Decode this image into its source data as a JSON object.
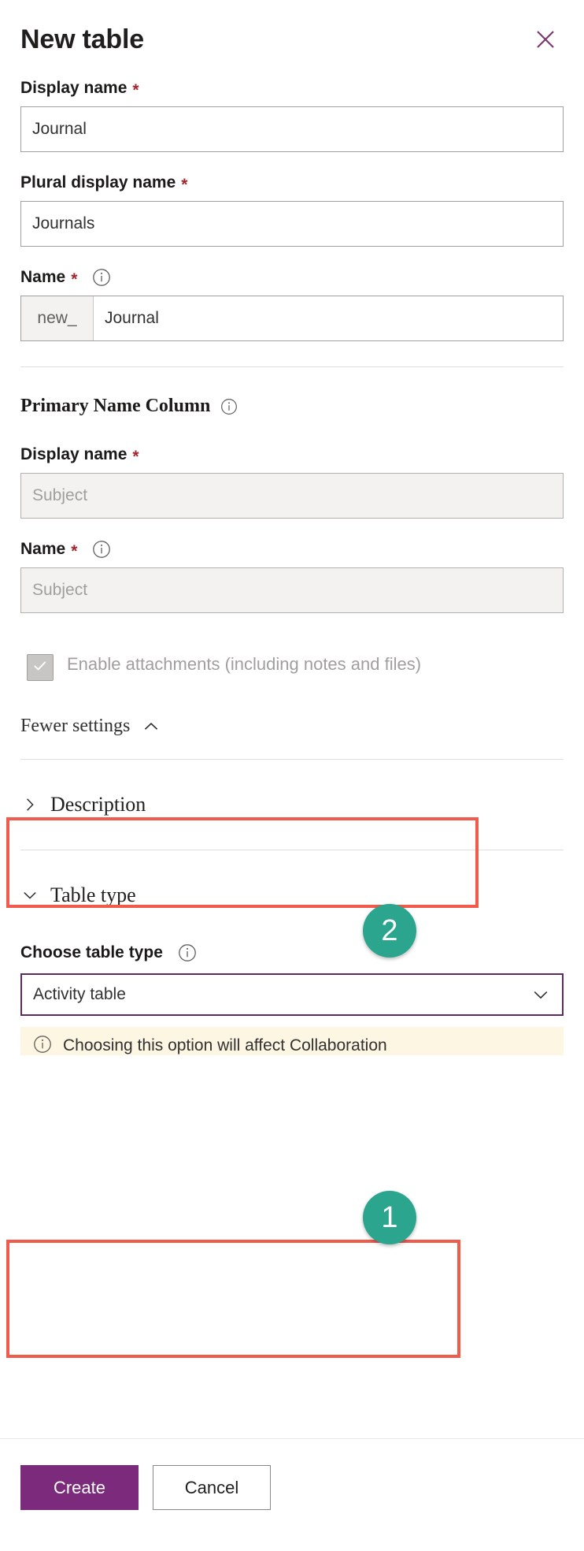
{
  "header": {
    "title": "New table",
    "close_icon": "close-icon"
  },
  "form": {
    "display_name": {
      "label": "Display name",
      "required_marker": "*",
      "value": "Journal"
    },
    "plural_display_name": {
      "label": "Plural display name",
      "required_marker": "*",
      "value": "Journals"
    },
    "name": {
      "label": "Name",
      "required_marker": "*",
      "prefix": "new_",
      "value": "Journal",
      "info_icon": "info-icon"
    },
    "primary_name_column": {
      "heading": "Primary Name Column",
      "info_icon": "info-icon",
      "display_name": {
        "label": "Display name",
        "required_marker": "*",
        "placeholder": "Subject",
        "value": "",
        "disabled": true
      },
      "name": {
        "label": "Name",
        "required_marker": "*",
        "placeholder": "Subject",
        "value": "",
        "disabled": true,
        "info_icon": "info-icon"
      }
    },
    "enable_attachments": {
      "label": "Enable attachments (including notes and files)",
      "checked": true,
      "disabled": true,
      "check_icon": "check-icon"
    },
    "fewer_settings": {
      "label": "Fewer settings",
      "chevron_icon": "chevron-up-icon"
    },
    "description_section": {
      "label": "Description",
      "chevron_icon": "chevron-right-icon",
      "expanded": false
    },
    "table_type_section": {
      "label": "Table type",
      "chevron_icon": "chevron-down-icon",
      "expanded": true,
      "choose_table_type": {
        "label": "Choose table type",
        "info_icon": "info-icon",
        "selected": "Activity table",
        "chevron_icon": "chevron-down-icon"
      },
      "warning": {
        "icon": "info-circle-icon",
        "text": "Choosing this option will affect Collaboration"
      }
    }
  },
  "footer": {
    "create_label": "Create",
    "cancel_label": "Cancel"
  },
  "annotations": [
    {
      "id": "badge-1",
      "number": "1"
    },
    {
      "id": "badge-2",
      "number": "2"
    }
  ],
  "colors": {
    "accent_purple": "#7c2a7c",
    "dropdown_border": "#5c2d5c",
    "highlight_red": "#f15b4c",
    "badge_teal": "#2ba58d",
    "required_red": "#a4262c",
    "warning_bg": "#fdf6e3"
  }
}
